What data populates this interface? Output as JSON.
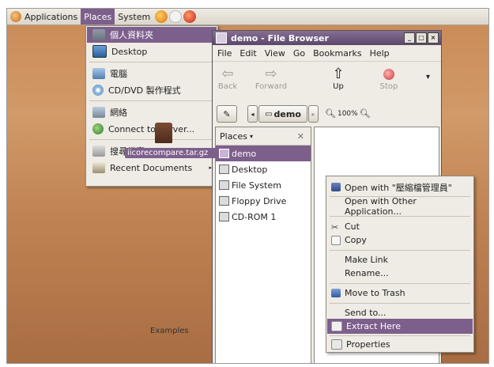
{
  "panel": {
    "applications": "Applications",
    "places": "Places",
    "system": "System"
  },
  "places_menu": {
    "items": [
      {
        "label": "個人資料夾",
        "icon": "home-folder-icon"
      },
      {
        "label": "Desktop",
        "icon": "desktop-icon"
      },
      {
        "label": "電腦",
        "icon": "computer-icon"
      },
      {
        "label": "CD/DVD 製作程式",
        "icon": "cd-icon"
      },
      {
        "label": "網絡",
        "icon": "network-icon"
      },
      {
        "label": "Connect to Server...",
        "icon": "globe-icon"
      },
      {
        "label": "搜尋檔案...",
        "icon": "search-icon"
      },
      {
        "label": "Recent Documents",
        "icon": "documents-icon",
        "submenu": "▸"
      }
    ]
  },
  "window": {
    "title": "demo - File Browser",
    "menus": [
      "File",
      "Edit",
      "View",
      "Go",
      "Bookmarks",
      "Help"
    ],
    "toolbar": {
      "back": "Back",
      "forward": "Forward",
      "up": "Up",
      "stop": "Stop"
    },
    "location": {
      "folder": "demo",
      "zoom": "100%"
    },
    "side_pane": {
      "header": "Places",
      "header_arrow": "▾",
      "close": "✕",
      "items": [
        "demo",
        "Desktop",
        "File System",
        "Floppy Drive",
        "CD-ROM 1"
      ]
    },
    "file": {
      "name": "iicorecompare.tar.gz"
    },
    "partial_label": "Examples"
  },
  "context_menu": {
    "items": [
      {
        "label": "Open with \"壓縮檔管理員\"",
        "icon": "archive-manager-icon"
      },
      {
        "label": "Open with Other Application..."
      },
      {
        "label": "Cut",
        "icon": "cut-icon"
      },
      {
        "label": "Copy",
        "icon": "copy-icon"
      },
      {
        "label": "Make Link"
      },
      {
        "label": "Rename..."
      },
      {
        "label": "Move to Trash",
        "icon": "trash-icon"
      },
      {
        "label": "Send to..."
      },
      {
        "label": "Extract Here",
        "icon": "extract-icon"
      },
      {
        "label": "Properties",
        "icon": "properties-icon"
      }
    ]
  },
  "colors": {
    "selection": "#7d5f8c",
    "menu_bg": "#efebe5",
    "desktop": "#c98a57"
  }
}
